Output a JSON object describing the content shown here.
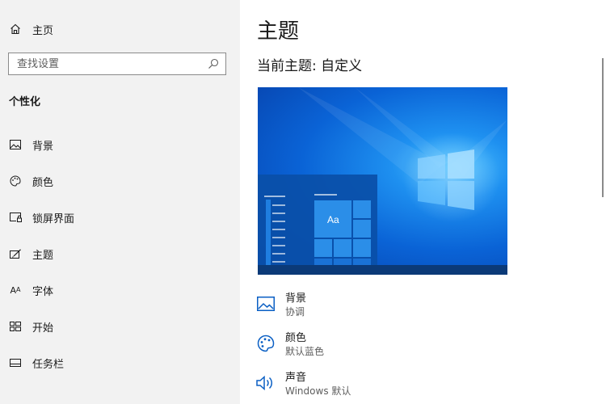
{
  "sidebar": {
    "home_label": "主页",
    "search_placeholder": "查找设置",
    "section_title": "个性化",
    "items": [
      {
        "label": "背景",
        "icon": "picture-icon"
      },
      {
        "label": "颜色",
        "icon": "palette-icon"
      },
      {
        "label": "锁屏界面",
        "icon": "lock-screen-icon"
      },
      {
        "label": "主题",
        "icon": "theme-icon"
      },
      {
        "label": "字体",
        "icon": "font-icon"
      },
      {
        "label": "开始",
        "icon": "start-icon"
      },
      {
        "label": "任务栏",
        "icon": "taskbar-icon"
      }
    ]
  },
  "main": {
    "title": "主题",
    "current_theme": "当前主题: 自定义",
    "preview_sample_text": "Aa",
    "settings": [
      {
        "title": "背景",
        "value": "协调",
        "icon": "picture-icon"
      },
      {
        "title": "颜色",
        "value": "默认蓝色",
        "icon": "palette-icon"
      },
      {
        "title": "声音",
        "value": "Windows 默认",
        "icon": "speaker-icon"
      }
    ]
  },
  "colors": {
    "accent": "#0078d7",
    "sidebar_bg": "#f2f2f2",
    "preview_sky": "#0a63d6"
  }
}
